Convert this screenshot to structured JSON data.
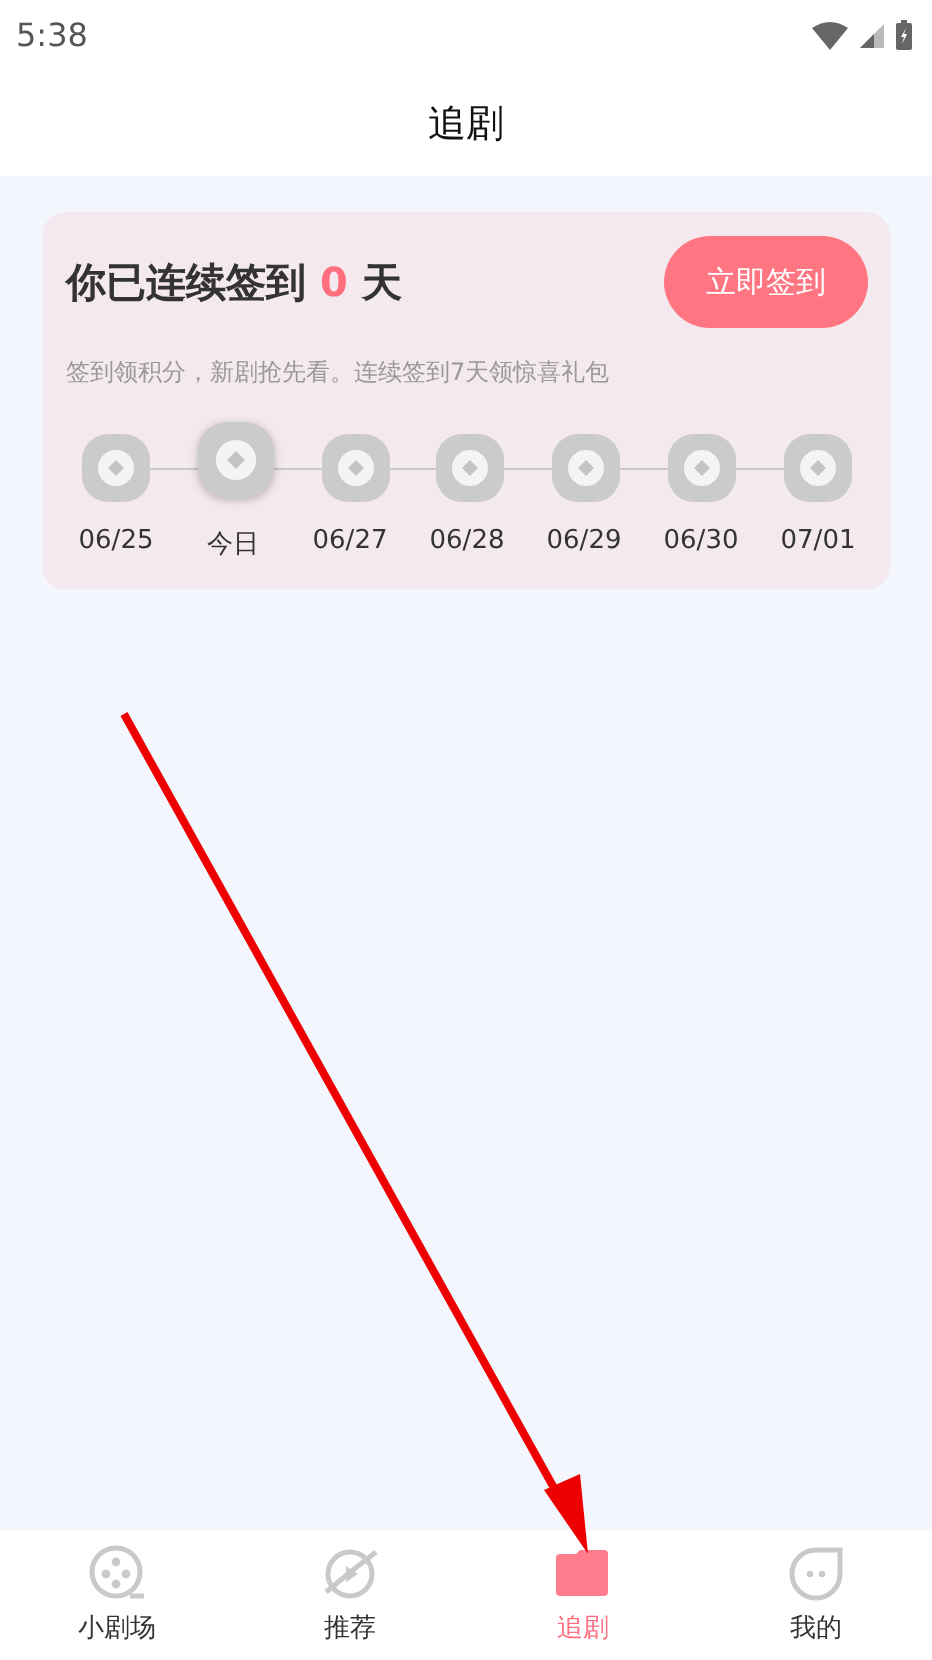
{
  "status_bar": {
    "time": "5:38"
  },
  "header": {
    "title": "追剧"
  },
  "checkin": {
    "heading_before": "你已连续签到",
    "count": "0",
    "heading_after": "天",
    "button": "立即签到",
    "hint": "签到领积分，新剧抢先看。连续签到7天领惊喜礼包",
    "days": [
      {
        "label": "06/25",
        "selected": false
      },
      {
        "label": "今日",
        "selected": true
      },
      {
        "label": "06/27",
        "selected": false
      },
      {
        "label": "06/28",
        "selected": false
      },
      {
        "label": "06/29",
        "selected": false
      },
      {
        "label": "06/30",
        "selected": false
      },
      {
        "label": "07/01",
        "selected": false
      }
    ]
  },
  "tabs": [
    {
      "label": "小剧场",
      "kind": "reel",
      "selected": false
    },
    {
      "label": "推荐",
      "kind": "planet",
      "selected": false
    },
    {
      "label": "追剧",
      "kind": "folder",
      "selected": true
    },
    {
      "label": "我的",
      "kind": "face",
      "selected": false
    }
  ]
}
